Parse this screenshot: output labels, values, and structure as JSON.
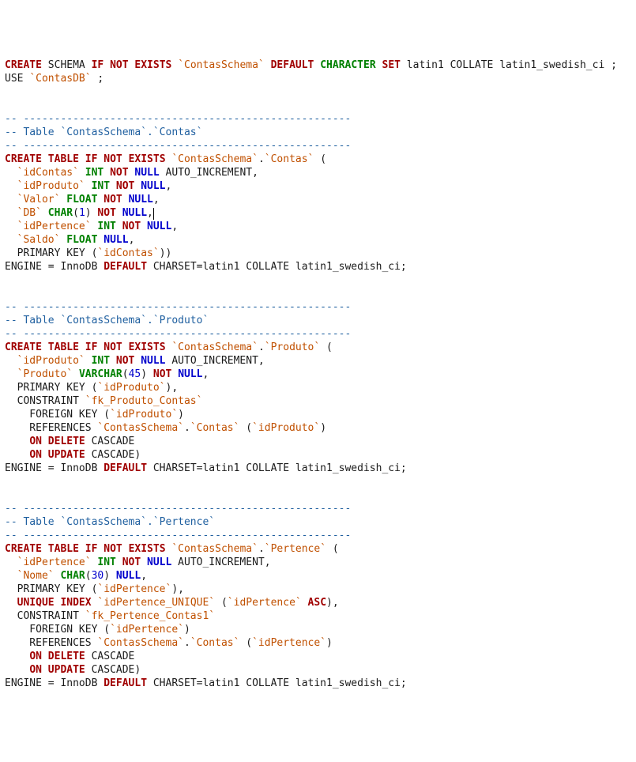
{
  "tokens": [
    [
      "kw-red",
      "CREATE"
    ],
    [
      "plain",
      " SCHEMA "
    ],
    [
      "kw-red",
      "IF"
    ],
    [
      "plain",
      " "
    ],
    [
      "kw-red",
      "NOT"
    ],
    [
      "plain",
      " "
    ],
    [
      "kw-red",
      "EXISTS"
    ],
    [
      "plain",
      " "
    ],
    [
      "backtick",
      "`ContasSchema`"
    ],
    [
      "plain",
      " "
    ],
    [
      "kw-red",
      "DEFAULT"
    ],
    [
      "plain",
      " "
    ],
    [
      "kw-green",
      "CHARACTER"
    ],
    [
      "plain",
      " "
    ],
    [
      "kw-red",
      "SET"
    ],
    [
      "plain",
      " latin1 COLLATE latin1_swedish_ci ;"
    ],
    [
      "nl",
      ""
    ],
    [
      "plain",
      "USE "
    ],
    [
      "backtick",
      "`ContasDB`"
    ],
    [
      "plain",
      " ;"
    ],
    [
      "nl",
      ""
    ],
    [
      "nl",
      ""
    ],
    [
      "nl",
      ""
    ],
    [
      "comment",
      "-- -----------------------------------------------------"
    ],
    [
      "nl",
      ""
    ],
    [
      "comment",
      "-- Table `ContasSchema`.`Contas`"
    ],
    [
      "nl",
      ""
    ],
    [
      "comment",
      "-- -----------------------------------------------------"
    ],
    [
      "nl",
      ""
    ],
    [
      "kw-red",
      "CREATE"
    ],
    [
      "plain",
      " "
    ],
    [
      "kw-red",
      "TABLE"
    ],
    [
      "plain",
      " "
    ],
    [
      "kw-red",
      "IF"
    ],
    [
      "plain",
      " "
    ],
    [
      "kw-red",
      "NOT"
    ],
    [
      "plain",
      " "
    ],
    [
      "kw-red",
      "EXISTS"
    ],
    [
      "plain",
      " "
    ],
    [
      "backtick",
      "`ContasSchema`"
    ],
    [
      "plain",
      "."
    ],
    [
      "backtick",
      "`Contas`"
    ],
    [
      "plain",
      " ("
    ],
    [
      "nl",
      ""
    ],
    [
      "plain",
      "  "
    ],
    [
      "backtick",
      "`idContas`"
    ],
    [
      "plain",
      " "
    ],
    [
      "kw-green",
      "INT"
    ],
    [
      "plain",
      " "
    ],
    [
      "kw-red",
      "NOT"
    ],
    [
      "plain",
      " "
    ],
    [
      "kw-blue",
      "NULL"
    ],
    [
      "plain",
      " AUTO_INCREMENT,"
    ],
    [
      "nl",
      ""
    ],
    [
      "plain",
      "  "
    ],
    [
      "backtick",
      "`idProduto`"
    ],
    [
      "plain",
      " "
    ],
    [
      "kw-green",
      "INT"
    ],
    [
      "plain",
      " "
    ],
    [
      "kw-red",
      "NOT"
    ],
    [
      "plain",
      " "
    ],
    [
      "kw-blue",
      "NULL"
    ],
    [
      "plain",
      ","
    ],
    [
      "nl",
      ""
    ],
    [
      "plain",
      "  "
    ],
    [
      "backtick",
      "`Valor`"
    ],
    [
      "plain",
      " "
    ],
    [
      "kw-green",
      "FLOAT"
    ],
    [
      "plain",
      " "
    ],
    [
      "kw-red",
      "NOT"
    ],
    [
      "plain",
      " "
    ],
    [
      "kw-blue",
      "NULL"
    ],
    [
      "plain",
      ","
    ],
    [
      "nl",
      ""
    ],
    [
      "plain",
      "  "
    ],
    [
      "backtick",
      "`DB`"
    ],
    [
      "plain",
      " "
    ],
    [
      "kw-green",
      "CHAR"
    ],
    [
      "plain",
      "("
    ],
    [
      "num",
      "1"
    ],
    [
      "plain",
      ") "
    ],
    [
      "kw-red",
      "NOT"
    ],
    [
      "plain",
      " "
    ],
    [
      "kw-blue",
      "NULL"
    ],
    [
      "plain",
      ","
    ],
    [
      "cursor",
      ""
    ],
    [
      "nl",
      ""
    ],
    [
      "plain",
      "  "
    ],
    [
      "backtick",
      "`idPertence`"
    ],
    [
      "plain",
      " "
    ],
    [
      "kw-green",
      "INT"
    ],
    [
      "plain",
      " "
    ],
    [
      "kw-red",
      "NOT"
    ],
    [
      "plain",
      " "
    ],
    [
      "kw-blue",
      "NULL"
    ],
    [
      "plain",
      ","
    ],
    [
      "nl",
      ""
    ],
    [
      "plain",
      "  "
    ],
    [
      "backtick",
      "`Saldo`"
    ],
    [
      "plain",
      " "
    ],
    [
      "kw-green",
      "FLOAT"
    ],
    [
      "plain",
      " "
    ],
    [
      "kw-blue",
      "NULL"
    ],
    [
      "plain",
      ","
    ],
    [
      "nl",
      ""
    ],
    [
      "plain",
      "  PRIMARY KEY ("
    ],
    [
      "backtick",
      "`idContas`"
    ],
    [
      "plain",
      "))"
    ],
    [
      "nl",
      ""
    ],
    [
      "plain",
      "ENGINE = InnoDB "
    ],
    [
      "kw-red",
      "DEFAULT"
    ],
    [
      "plain",
      " CHARSET=latin1 COLLATE latin1_swedish_ci;"
    ],
    [
      "nl",
      ""
    ],
    [
      "nl",
      ""
    ],
    [
      "nl",
      ""
    ],
    [
      "comment",
      "-- -----------------------------------------------------"
    ],
    [
      "nl",
      ""
    ],
    [
      "comment",
      "-- Table `ContasSchema`.`Produto`"
    ],
    [
      "nl",
      ""
    ],
    [
      "comment",
      "-- -----------------------------------------------------"
    ],
    [
      "nl",
      ""
    ],
    [
      "kw-red",
      "CREATE"
    ],
    [
      "plain",
      " "
    ],
    [
      "kw-red",
      "TABLE"
    ],
    [
      "plain",
      " "
    ],
    [
      "kw-red",
      "IF"
    ],
    [
      "plain",
      " "
    ],
    [
      "kw-red",
      "NOT"
    ],
    [
      "plain",
      " "
    ],
    [
      "kw-red",
      "EXISTS"
    ],
    [
      "plain",
      " "
    ],
    [
      "backtick",
      "`ContasSchema`"
    ],
    [
      "plain",
      "."
    ],
    [
      "backtick",
      "`Produto`"
    ],
    [
      "plain",
      " ("
    ],
    [
      "nl",
      ""
    ],
    [
      "plain",
      "  "
    ],
    [
      "backtick",
      "`idProduto`"
    ],
    [
      "plain",
      " "
    ],
    [
      "kw-green",
      "INT"
    ],
    [
      "plain",
      " "
    ],
    [
      "kw-red",
      "NOT"
    ],
    [
      "plain",
      " "
    ],
    [
      "kw-blue",
      "NULL"
    ],
    [
      "plain",
      " AUTO_INCREMENT,"
    ],
    [
      "nl",
      ""
    ],
    [
      "plain",
      "  "
    ],
    [
      "backtick",
      "`Produto`"
    ],
    [
      "plain",
      " "
    ],
    [
      "kw-green",
      "VARCHAR"
    ],
    [
      "plain",
      "("
    ],
    [
      "num",
      "45"
    ],
    [
      "plain",
      ") "
    ],
    [
      "kw-red",
      "NOT"
    ],
    [
      "plain",
      " "
    ],
    [
      "kw-blue",
      "NULL"
    ],
    [
      "plain",
      ","
    ],
    [
      "nl",
      ""
    ],
    [
      "plain",
      "  PRIMARY KEY ("
    ],
    [
      "backtick",
      "`idProduto`"
    ],
    [
      "plain",
      "),"
    ],
    [
      "nl",
      ""
    ],
    [
      "plain",
      "  CONSTRAINT "
    ],
    [
      "backtick",
      "`fk_Produto_Contas`"
    ],
    [
      "nl",
      ""
    ],
    [
      "plain",
      "    FOREIGN KEY ("
    ],
    [
      "backtick",
      "`idProduto`"
    ],
    [
      "plain",
      ")"
    ],
    [
      "nl",
      ""
    ],
    [
      "plain",
      "    REFERENCES "
    ],
    [
      "backtick",
      "`ContasSchema`"
    ],
    [
      "plain",
      "."
    ],
    [
      "backtick",
      "`Contas`"
    ],
    [
      "plain",
      " ("
    ],
    [
      "backtick",
      "`idProduto`"
    ],
    [
      "plain",
      ")"
    ],
    [
      "nl",
      ""
    ],
    [
      "plain",
      "    "
    ],
    [
      "kw-red",
      "ON"
    ],
    [
      "plain",
      " "
    ],
    [
      "kw-red",
      "DELETE"
    ],
    [
      "plain",
      " CASCADE"
    ],
    [
      "nl",
      ""
    ],
    [
      "plain",
      "    "
    ],
    [
      "kw-red",
      "ON"
    ],
    [
      "plain",
      " "
    ],
    [
      "kw-red",
      "UPDATE"
    ],
    [
      "plain",
      " CASCADE)"
    ],
    [
      "nl",
      ""
    ],
    [
      "plain",
      "ENGINE = InnoDB "
    ],
    [
      "kw-red",
      "DEFAULT"
    ],
    [
      "plain",
      " CHARSET=latin1 COLLATE latin1_swedish_ci;"
    ],
    [
      "nl",
      ""
    ],
    [
      "nl",
      ""
    ],
    [
      "nl",
      ""
    ],
    [
      "comment",
      "-- -----------------------------------------------------"
    ],
    [
      "nl",
      ""
    ],
    [
      "comment",
      "-- Table `ContasSchema`.`Pertence`"
    ],
    [
      "nl",
      ""
    ],
    [
      "comment",
      "-- -----------------------------------------------------"
    ],
    [
      "nl",
      ""
    ],
    [
      "kw-red",
      "CREATE"
    ],
    [
      "plain",
      " "
    ],
    [
      "kw-red",
      "TABLE"
    ],
    [
      "plain",
      " "
    ],
    [
      "kw-red",
      "IF"
    ],
    [
      "plain",
      " "
    ],
    [
      "kw-red",
      "NOT"
    ],
    [
      "plain",
      " "
    ],
    [
      "kw-red",
      "EXISTS"
    ],
    [
      "plain",
      " "
    ],
    [
      "backtick",
      "`ContasSchema`"
    ],
    [
      "plain",
      "."
    ],
    [
      "backtick",
      "`Pertence`"
    ],
    [
      "plain",
      " ("
    ],
    [
      "nl",
      ""
    ],
    [
      "plain",
      "  "
    ],
    [
      "backtick",
      "`idPertence`"
    ],
    [
      "plain",
      " "
    ],
    [
      "kw-green",
      "INT"
    ],
    [
      "plain",
      " "
    ],
    [
      "kw-red",
      "NOT"
    ],
    [
      "plain",
      " "
    ],
    [
      "kw-blue",
      "NULL"
    ],
    [
      "plain",
      " AUTO_INCREMENT,"
    ],
    [
      "nl",
      ""
    ],
    [
      "plain",
      "  "
    ],
    [
      "backtick",
      "`Nome`"
    ],
    [
      "plain",
      " "
    ],
    [
      "kw-green",
      "CHAR"
    ],
    [
      "plain",
      "("
    ],
    [
      "num",
      "30"
    ],
    [
      "plain",
      ") "
    ],
    [
      "kw-blue",
      "NULL"
    ],
    [
      "plain",
      ","
    ],
    [
      "nl",
      ""
    ],
    [
      "plain",
      "  PRIMARY KEY ("
    ],
    [
      "backtick",
      "`idPertence`"
    ],
    [
      "plain",
      "),"
    ],
    [
      "nl",
      ""
    ],
    [
      "plain",
      "  "
    ],
    [
      "kw-red",
      "UNIQUE"
    ],
    [
      "plain",
      " "
    ],
    [
      "kw-red",
      "INDEX"
    ],
    [
      "plain",
      " "
    ],
    [
      "backtick",
      "`idPertence_UNIQUE`"
    ],
    [
      "plain",
      " ("
    ],
    [
      "backtick",
      "`idPertence`"
    ],
    [
      "plain",
      " "
    ],
    [
      "kw-red",
      "ASC"
    ],
    [
      "plain",
      "),"
    ],
    [
      "nl",
      ""
    ],
    [
      "plain",
      "  CONSTRAINT "
    ],
    [
      "backtick",
      "`fk_Pertence_Contas1`"
    ],
    [
      "nl",
      ""
    ],
    [
      "plain",
      "    FOREIGN KEY ("
    ],
    [
      "backtick",
      "`idPertence`"
    ],
    [
      "plain",
      ")"
    ],
    [
      "nl",
      ""
    ],
    [
      "plain",
      "    REFERENCES "
    ],
    [
      "backtick",
      "`ContasSchema`"
    ],
    [
      "plain",
      "."
    ],
    [
      "backtick",
      "`Contas`"
    ],
    [
      "plain",
      " ("
    ],
    [
      "backtick",
      "`idPertence`"
    ],
    [
      "plain",
      ")"
    ],
    [
      "nl",
      ""
    ],
    [
      "plain",
      "    "
    ],
    [
      "kw-red",
      "ON"
    ],
    [
      "plain",
      " "
    ],
    [
      "kw-red",
      "DELETE"
    ],
    [
      "plain",
      " CASCADE"
    ],
    [
      "nl",
      ""
    ],
    [
      "plain",
      "    "
    ],
    [
      "kw-red",
      "ON"
    ],
    [
      "plain",
      " "
    ],
    [
      "kw-red",
      "UPDATE"
    ],
    [
      "plain",
      " CASCADE)"
    ],
    [
      "nl",
      ""
    ],
    [
      "plain",
      "ENGINE = InnoDB "
    ],
    [
      "kw-red",
      "DEFAULT"
    ],
    [
      "plain",
      " CHARSET=latin1 COLLATE latin1_swedish_ci;"
    ]
  ]
}
